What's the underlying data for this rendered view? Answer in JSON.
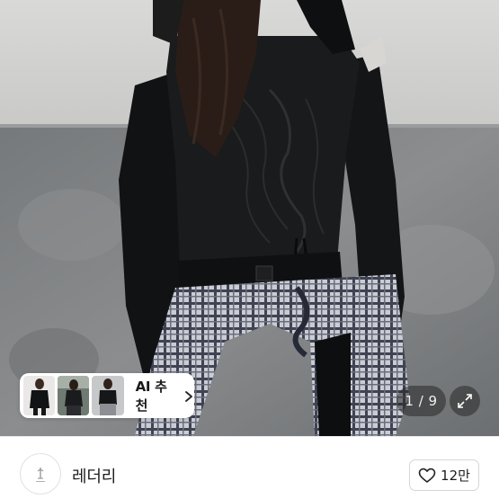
{
  "hero": {
    "image_name": "product-photo-black-shirred-top",
    "pager": "1 / 9"
  },
  "ai_recommend": {
    "label": "AI 추천",
    "thumb_count": 3
  },
  "seller": {
    "shop_name": "레더리",
    "likes": "12만"
  },
  "icons": {
    "expand": "expand-icon",
    "heart": "heart-icon",
    "chevron": "chevron-right-icon",
    "avatar_logo": "shop-logo-icon"
  }
}
